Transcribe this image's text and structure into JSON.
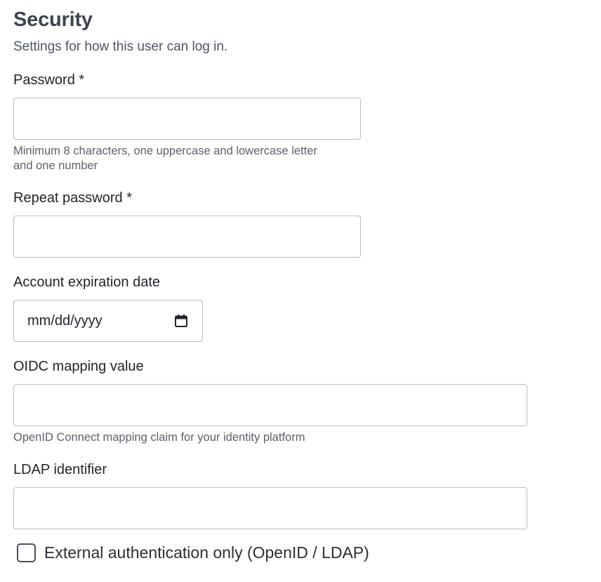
{
  "section": {
    "title": "Security",
    "description": "Settings for how this user can log in."
  },
  "password": {
    "label": "Password *",
    "value": "",
    "hint_line1": "Minimum 8 characters, one uppercase and lowercase letter",
    "hint_line2": "and one number"
  },
  "repeat_password": {
    "label": "Repeat password *",
    "value": ""
  },
  "expiration": {
    "label": "Account expiration date",
    "placeholder": "mm/dd/yyyy",
    "icon": "calendar-icon"
  },
  "oidc": {
    "label": "OIDC mapping value",
    "value": "",
    "hint": "OpenID Connect mapping claim for your identity platform"
  },
  "ldap": {
    "label": "LDAP identifier",
    "value": ""
  },
  "external_auth": {
    "label": "External authentication only (OpenID / LDAP)",
    "checked": false
  }
}
